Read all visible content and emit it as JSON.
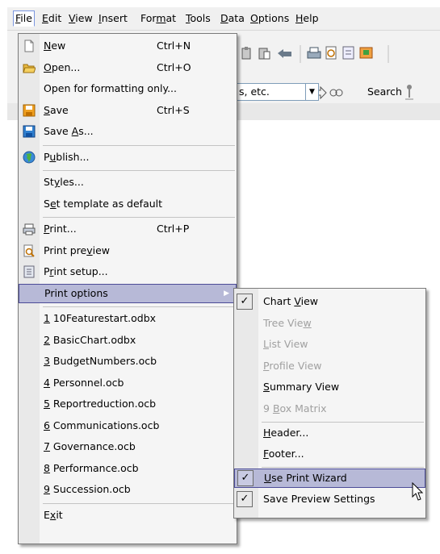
{
  "menubar": {
    "items": [
      {
        "label": "File",
        "mn": 0
      },
      {
        "label": "Edit",
        "mn": 0
      },
      {
        "label": "View",
        "mn": 0
      },
      {
        "label": "Insert",
        "mn": 0
      },
      {
        "label": "Format",
        "mn": 3
      },
      {
        "label": "Tools",
        "mn": 0
      },
      {
        "label": "Data",
        "mn": 0
      },
      {
        "label": "Options",
        "mn": 0
      },
      {
        "label": "Help",
        "mn": 0
      }
    ]
  },
  "toolbar": {
    "combo_value": "s, etc.",
    "search_label": "Search"
  },
  "file_menu": {
    "items": [
      {
        "type": "item",
        "label": "New",
        "mn": 0,
        "shortcut": "Ctrl+N",
        "icon": "new-document-icon"
      },
      {
        "type": "item",
        "label": "Open...",
        "mn": 0,
        "shortcut": "Ctrl+O",
        "icon": "open-folder-icon"
      },
      {
        "type": "item",
        "label": "Open for formatting only...",
        "mn": -1,
        "shortcut": "",
        "icon": ""
      },
      {
        "type": "item",
        "label": "Save",
        "mn": 0,
        "shortcut": "Ctrl+S",
        "icon": "save-icon"
      },
      {
        "type": "item",
        "label": "Save As...",
        "mn": 5,
        "shortcut": "",
        "icon": "save-as-icon"
      },
      {
        "type": "sep"
      },
      {
        "type": "item",
        "label": "Publish...",
        "mn": 1,
        "shortcut": "",
        "icon": "globe-icon"
      },
      {
        "type": "sep"
      },
      {
        "type": "item",
        "label": "Styles...",
        "mn": 2,
        "shortcut": "",
        "icon": ""
      },
      {
        "type": "item",
        "label": "Set template as default",
        "mn": 1,
        "shortcut": "",
        "icon": ""
      },
      {
        "type": "sep"
      },
      {
        "type": "item",
        "label": "Print...",
        "mn": 0,
        "shortcut": "Ctrl+P",
        "icon": "printer-icon"
      },
      {
        "type": "item",
        "label": "Print preview",
        "mn": 9,
        "shortcut": "",
        "icon": "print-preview-icon"
      },
      {
        "type": "item",
        "label": "Print setup...",
        "mn": 1,
        "shortcut": "",
        "icon": "print-setup-icon"
      },
      {
        "type": "item",
        "label": "Print options",
        "mn": -1,
        "shortcut": "",
        "icon": "",
        "submenu": true,
        "highlighted": true
      },
      {
        "type": "sep"
      },
      {
        "type": "item",
        "label": "1 10Featurestart.odbx",
        "mn": 0,
        "shortcut": "",
        "icon": ""
      },
      {
        "type": "item",
        "label": "2 BasicChart.odbx",
        "mn": 0,
        "shortcut": "",
        "icon": ""
      },
      {
        "type": "item",
        "label": "3 BudgetNumbers.ocb",
        "mn": 0,
        "shortcut": "",
        "icon": ""
      },
      {
        "type": "item",
        "label": "4 Personnel.ocb",
        "mn": 0,
        "shortcut": "",
        "icon": ""
      },
      {
        "type": "item",
        "label": "5 Reportreduction.ocb",
        "mn": 0,
        "shortcut": "",
        "icon": ""
      },
      {
        "type": "item",
        "label": "6 Communications.ocb",
        "mn": 0,
        "shortcut": "",
        "icon": ""
      },
      {
        "type": "item",
        "label": "7 Governance.ocb",
        "mn": 0,
        "shortcut": "",
        "icon": ""
      },
      {
        "type": "item",
        "label": "8 Performance.ocb",
        "mn": 0,
        "shortcut": "",
        "icon": ""
      },
      {
        "type": "item",
        "label": "9 Succession.ocb",
        "mn": 0,
        "shortcut": "",
        "icon": ""
      },
      {
        "type": "sep"
      },
      {
        "type": "item",
        "label": "Exit",
        "mn": 1,
        "shortcut": "",
        "icon": ""
      }
    ]
  },
  "print_options_menu": {
    "items": [
      {
        "type": "item",
        "label": "Chart View",
        "mn": 6,
        "checked": true,
        "disabled": false
      },
      {
        "type": "item",
        "label": "Tree View",
        "mn": 8,
        "checked": false,
        "disabled": true
      },
      {
        "type": "item",
        "label": "List View",
        "mn": 0,
        "checked": false,
        "disabled": true
      },
      {
        "type": "item",
        "label": "Profile View",
        "mn": 0,
        "checked": false,
        "disabled": true
      },
      {
        "type": "item",
        "label": "Summary View",
        "mn": 0,
        "checked": false,
        "disabled": false
      },
      {
        "type": "item",
        "label": "9 Box Matrix",
        "mn": 2,
        "checked": false,
        "disabled": true
      },
      {
        "type": "sep"
      },
      {
        "type": "item",
        "label": "Header...",
        "mn": 0,
        "checked": false,
        "disabled": false
      },
      {
        "type": "item",
        "label": "Footer...",
        "mn": 0,
        "checked": false,
        "disabled": false
      },
      {
        "type": "sep"
      },
      {
        "type": "item",
        "label": "Use Print Wizard",
        "mn": 0,
        "checked": true,
        "disabled": false,
        "highlighted": true
      },
      {
        "type": "item",
        "label": "Save Preview Settings",
        "mn": -1,
        "checked": true,
        "disabled": false
      }
    ]
  }
}
